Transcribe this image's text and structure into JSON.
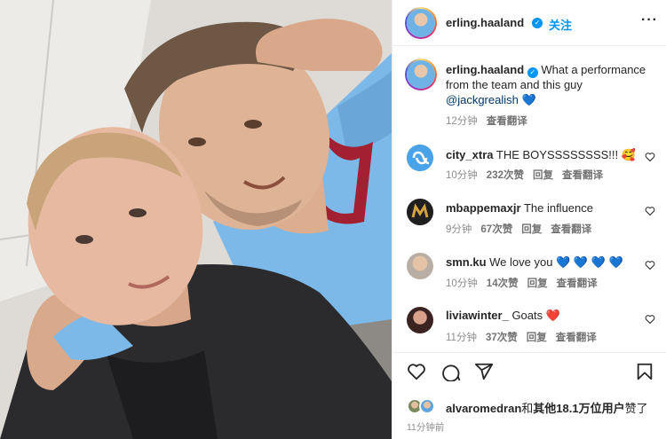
{
  "colors": {
    "accent": "#0095f6",
    "mention": "#00376b",
    "muted": "#8e8e8e",
    "verified": "#0095f6"
  },
  "post": {
    "username": "erling.haaland",
    "verified_icon": "verified-badge-icon",
    "follow_label": "关注",
    "more_label": "···"
  },
  "caption": {
    "username": "erling.haaland",
    "text": "What a performance from the team and this guy",
    "mention": "@jackgrealish",
    "emoji": "💙",
    "time": "12分钟",
    "translate": "查看翻译"
  },
  "comments": [
    {
      "username": "city_xtra",
      "text": "THE BOYSSSSSSSS!!!",
      "emoji": "🥰",
      "time": "10分钟",
      "likes": "232次赞",
      "reply": "回复",
      "translate": "查看翻译",
      "avatar": "city-xtra-logo"
    },
    {
      "username": "mbappemaxjr",
      "text": "The influence",
      "emoji": "",
      "time": "9分钟",
      "likes": "67次赞",
      "reply": "回复",
      "translate": "查看翻译",
      "avatar": "m-logo"
    },
    {
      "username": "smn.ku",
      "text": "We love you",
      "emoji": "💙 💙 💙 💙",
      "time": "10分钟",
      "likes": "14次赞",
      "reply": "回复",
      "translate": "查看翻译",
      "avatar": "profile-photo"
    },
    {
      "username": "liviawinter_",
      "text": "Goats",
      "emoji": "❤️",
      "time": "11分钟",
      "likes": "37次赞",
      "reply": "回复",
      "translate": "查看翻译",
      "avatar": "profile-photo"
    }
  ],
  "actions": {
    "like": "heart-icon",
    "comment": "comment-icon",
    "share": "share-icon",
    "save": "bookmark-icon"
  },
  "likes": {
    "first_user": "alvaromedran",
    "connector": "和",
    "others": "其他18.1万位用户",
    "suffix": "赞了"
  },
  "timestamp": "11分钟前"
}
